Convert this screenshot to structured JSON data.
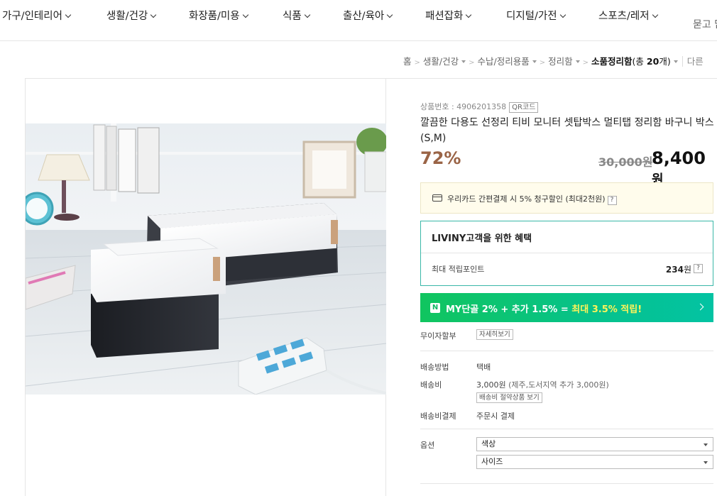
{
  "nav": {
    "categories": [
      {
        "label": "가구/인테리어"
      },
      {
        "label": "생활/건강"
      },
      {
        "label": "화장품/미용"
      },
      {
        "label": "식품"
      },
      {
        "label": "출산/육아"
      },
      {
        "label": "패션잡화"
      },
      {
        "label": "디지털/가전"
      },
      {
        "label": "스포츠/레저"
      }
    ],
    "more_label": "묻고 답"
  },
  "breadcrumb": {
    "home": "홈",
    "level1": "생활/건강",
    "level2": "수납/정리용품",
    "level3": "정리함",
    "current": "소품정리함",
    "count_prefix": "(총 ",
    "count": "20",
    "count_suffix": "개)",
    "other": "다른"
  },
  "product": {
    "number_label": "상품번호 : 4906201358",
    "qr_label": "QR코드",
    "title": "깔끔한 다용도 선정리 티비 모니터 셋탑박스 멀티탭 정리함 바구니 박스 (S,M)",
    "discount": "72%",
    "original_price": "30,000원",
    "price_value": "8,400",
    "price_unit": "원"
  },
  "card_promo": {
    "text": "우리카드 간편결제 시 5% 청구할인 (최대2천원)",
    "help": "?"
  },
  "benefit": {
    "title": "LIVINY고객을 위한 혜택",
    "point_label": "최대 적립포인트",
    "point_value": "234",
    "point_unit": "원",
    "help": "?"
  },
  "my_bar": {
    "badge": "N",
    "text_main": "MY단골 2% + 추가 1.5% = ",
    "text_highlight": "최대 3.5% 적립!"
  },
  "details": {
    "installment_label": "무이자할부",
    "installment_btn": "자세히보기",
    "shipping_method_label": "배송방법",
    "shipping_method_value": "택배",
    "shipping_fee_label": "배송비",
    "shipping_fee_value": "3,000원",
    "shipping_fee_note": " (제주,도서지역 추가 3,000원)",
    "shipping_fee_btn": "배송비 절약상품 보기",
    "shipping_pay_label": "배송비결제",
    "shipping_pay_value": "주문시 결제",
    "option_label": "옵션",
    "option_color": "색상",
    "option_size": "사이즈"
  }
}
